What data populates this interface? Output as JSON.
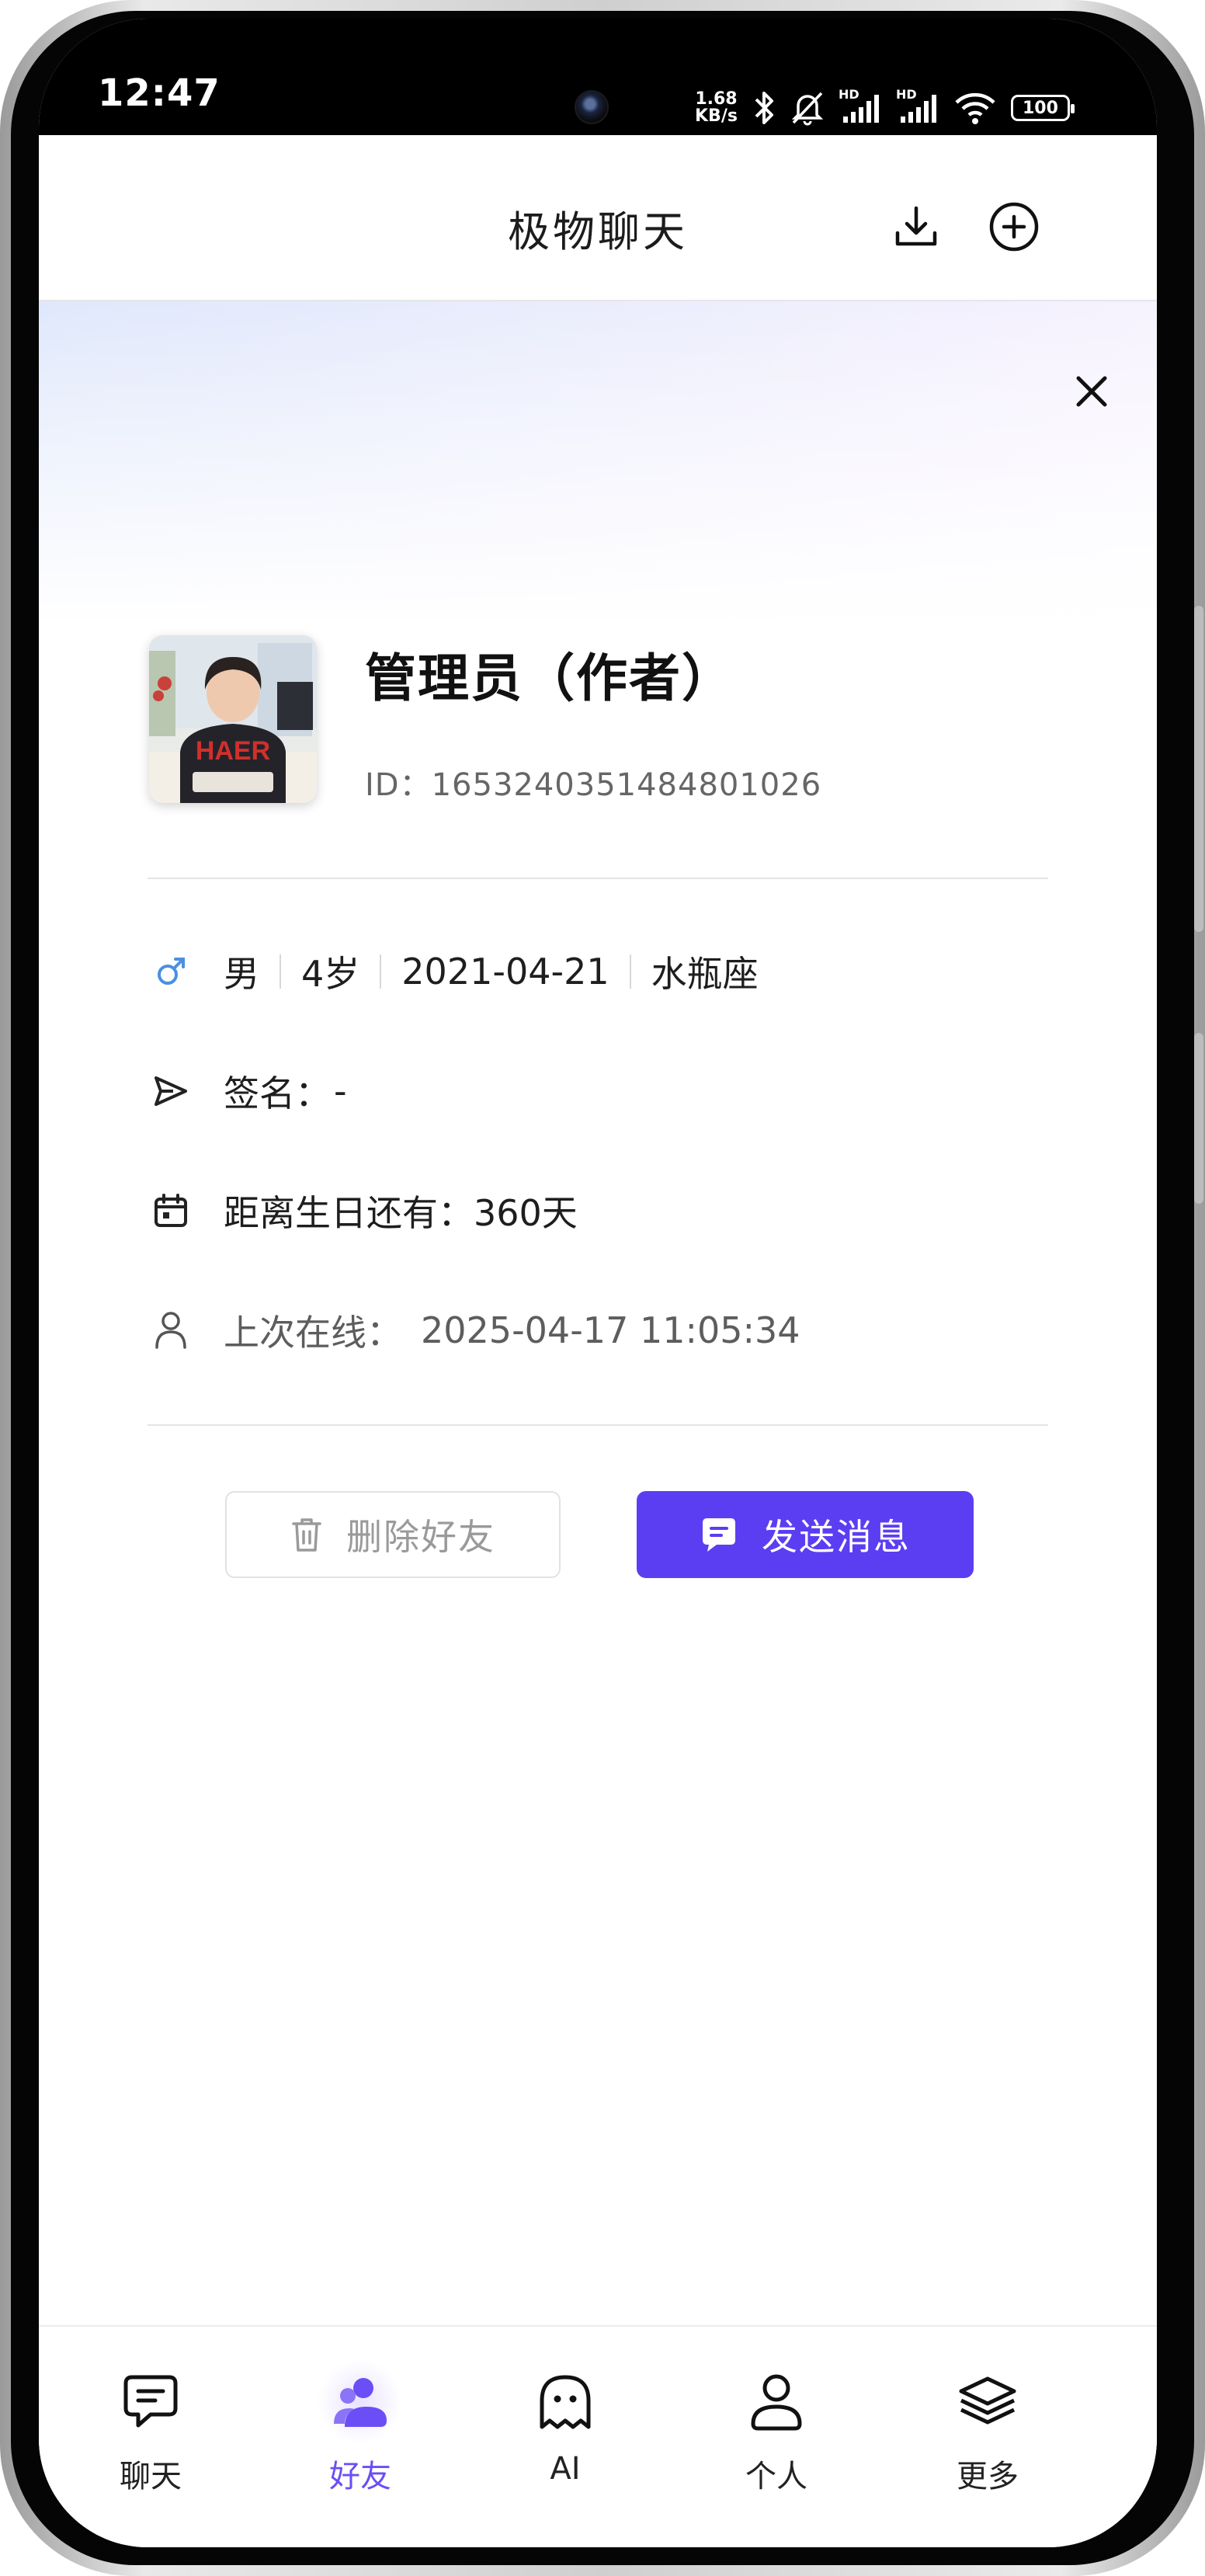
{
  "status_bar": {
    "time": "12:47",
    "net_speed_value": "1.68",
    "net_speed_unit": "KB/s",
    "hd_label_1": "HD",
    "hd_label_2": "HD",
    "battery": "100",
    "icons": [
      "bluetooth-icon",
      "mute-bell-icon",
      "signal-icon",
      "signal-icon",
      "wifi-icon",
      "battery-icon"
    ]
  },
  "header": {
    "title": "极物聊天",
    "icons": [
      "download-icon",
      "add-circle-icon"
    ]
  },
  "profile": {
    "name": "管理员（作者）",
    "id_label": "ID：",
    "id_value": "1653240351484801026",
    "gender_icon": "male-icon",
    "gender_color": "#4a90e2",
    "gender": "男",
    "age": "4岁",
    "birthday": "2021-04-21",
    "zodiac": "水瓶座",
    "signature_label": "签名：",
    "signature_value": "-",
    "birthday_countdown_label": "距离生日还有：",
    "birthday_countdown_value": "360天",
    "last_online_label": "上次在线：",
    "last_online_value": "2025-04-17 11:05:34"
  },
  "actions": {
    "delete_label": "删除好友",
    "send_label": "发送消息",
    "send_color": "#5b3ef2"
  },
  "tabbar": {
    "active_color": "#6b4ef5",
    "items": [
      {
        "label": "聊天",
        "icon": "chat-icon"
      },
      {
        "label": "好友",
        "icon": "friends-icon"
      },
      {
        "label": "AI",
        "icon": "ghost-icon"
      },
      {
        "label": "个人",
        "icon": "person-icon"
      },
      {
        "label": "更多",
        "icon": "layers-icon"
      }
    ]
  }
}
